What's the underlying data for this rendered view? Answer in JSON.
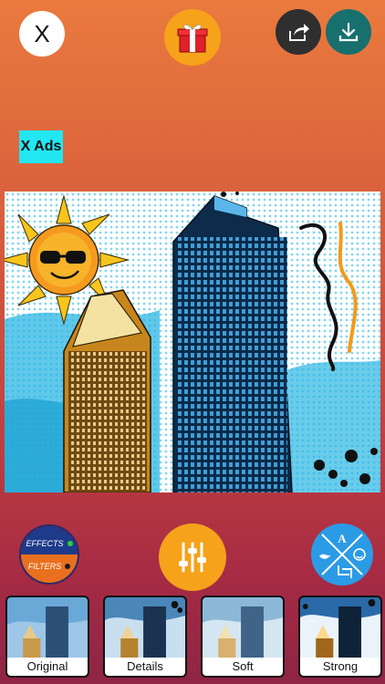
{
  "top_bar": {
    "close_label": "X",
    "gift_icon": "gift-icon",
    "share_icon": "share-icon",
    "download_icon": "download-icon"
  },
  "ads_button": {
    "label": "X Ads"
  },
  "controls": {
    "effects_label": "EFFECTS",
    "filters_label": "FILTERS",
    "adjust_icon": "sliders-icon",
    "tools_icon": "tools-icon"
  },
  "thumbnails": [
    {
      "label": "Original"
    },
    {
      "label": "Details"
    },
    {
      "label": "Soft"
    },
    {
      "label": "Strong"
    }
  ],
  "colors": {
    "accent_orange": "#f6a21a",
    "download_teal": "#17706e",
    "ads_cyan": "#22e6f2",
    "tools_blue": "#2b9be6"
  }
}
